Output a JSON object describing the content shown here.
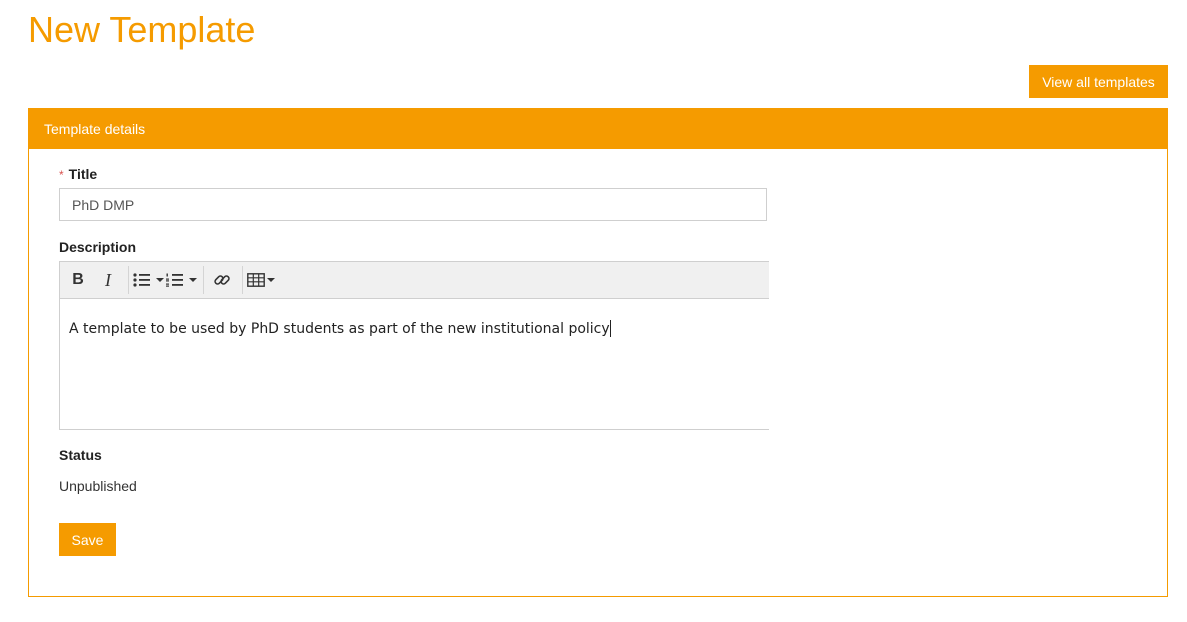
{
  "page": {
    "title": "New Template"
  },
  "header_actions": {
    "view_all_label": "View all templates"
  },
  "panel": {
    "heading": "Template details"
  },
  "form": {
    "title_label": "Title",
    "required_marker": "*",
    "title_value": "PhD DMP",
    "description_label": "Description",
    "description_text": "A template to be used by PhD students as part of the new institutional policy",
    "status_label": "Status",
    "status_value": "Unpublished",
    "save_label": "Save"
  },
  "editor_toolbar": {
    "tools": [
      "bold-icon",
      "italic-icon",
      "bullet-list-icon",
      "numbered-list-icon",
      "link-icon",
      "table-icon"
    ]
  },
  "colors": {
    "accent": "#f59b00",
    "required": "#d9534f"
  }
}
